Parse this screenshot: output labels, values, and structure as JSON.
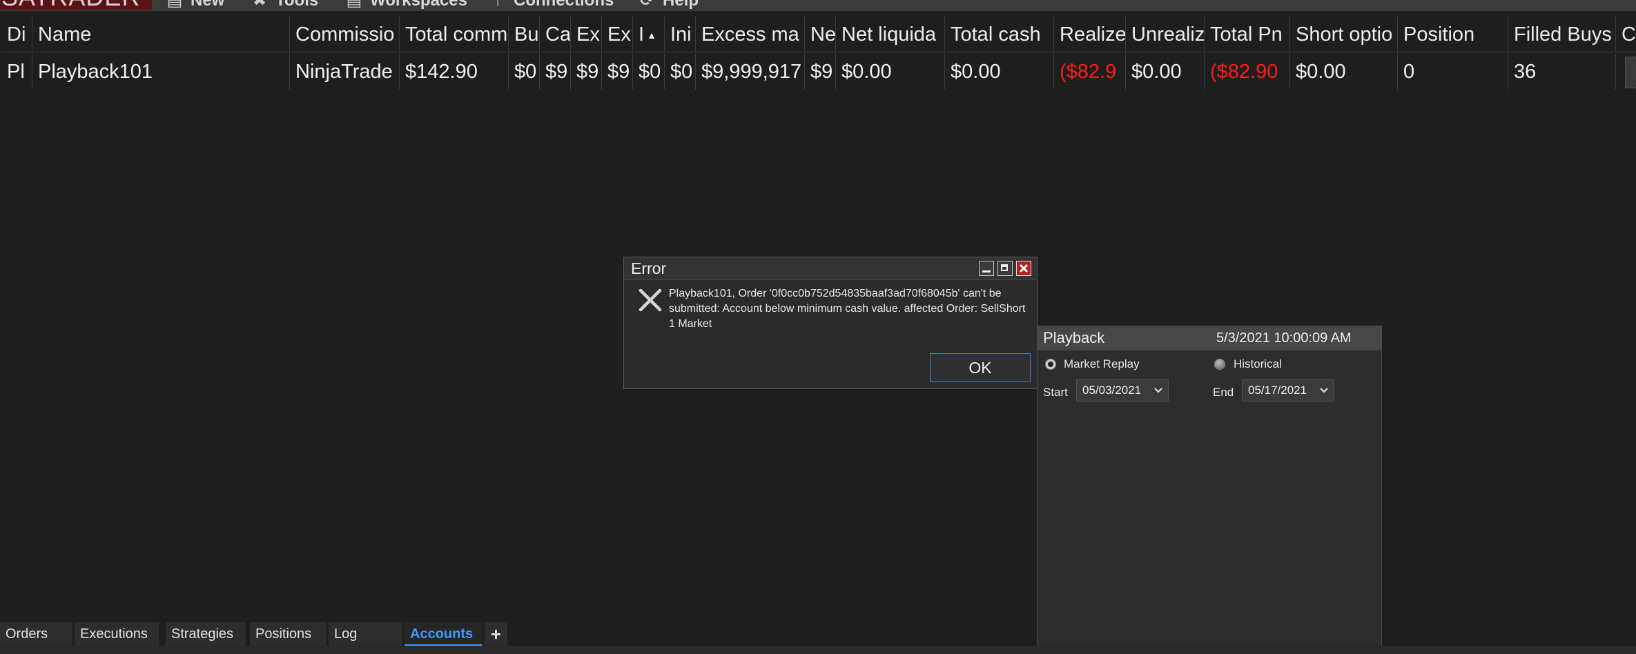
{
  "menubar": {
    "brand": "SATRADER",
    "items": [
      "New",
      "Tools",
      "Workspaces",
      "Connections",
      "Help"
    ]
  },
  "grid": {
    "headers": [
      "Di",
      "Name",
      "Commissio",
      "Total comm",
      "Bu",
      "Ca",
      "Ex",
      "Ex",
      "I",
      "Ini",
      "Excess ma",
      "Ne",
      "Net liquida",
      "Total cash",
      "Realize",
      "Unrealiz",
      "Total Pn",
      "Short optio",
      "Position",
      "Filled Buys",
      "C"
    ],
    "row": [
      "Pl",
      "Playback101",
      "NinjaTrade",
      "$142.90",
      "$0",
      "$9",
      "$9",
      "$9",
      "$0",
      "$0",
      "$9,999,917",
      "$9",
      "$0.00",
      "$0.00",
      "($82.9",
      "$0.00",
      "($82.90",
      "$0.00",
      "0",
      "36",
      ""
    ],
    "negative_color": "#ff1a1a"
  },
  "tabs": {
    "items": [
      "Orders",
      "Executions",
      "Strategies",
      "Positions",
      "Log",
      "Accounts"
    ],
    "active": "Accounts",
    "add_label": "+"
  },
  "dialog": {
    "title": "Error",
    "message": "Playback101, Order '0f0cc0b752d54835baaf3ad70f68045b' can't be submitted: Account below minimum cash value. affected Order: SellShort 1 Market",
    "ok_label": "OK"
  },
  "playback": {
    "title": "Playback",
    "time": "5/3/2021 10:00:09 AM",
    "market_replay_label": "Market Replay",
    "historical_label": "Historical",
    "start_label": "Start",
    "start_value": "05/03/2021",
    "end_label": "End",
    "end_value": "05/17/2021"
  }
}
